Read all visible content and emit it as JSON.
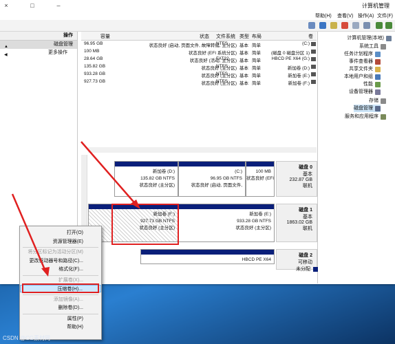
{
  "window": {
    "title": "计算机管理",
    "controls": {
      "close": "×",
      "maximize": "□",
      "minimize": "–"
    }
  },
  "menubar": [
    "文件(F)",
    "操作(A)",
    "查看(V)",
    "帮助(H)"
  ],
  "tree": {
    "items": [
      {
        "label": "计算机管理(本地)",
        "level": 0
      },
      {
        "label": "系统工具",
        "level": 1
      },
      {
        "label": "任务计划程序",
        "level": 2
      },
      {
        "label": "事件查看器",
        "level": 2
      },
      {
        "label": "共享文件夹",
        "level": 2
      },
      {
        "label": "本地用户和组",
        "level": 2
      },
      {
        "label": "性能",
        "level": 2
      },
      {
        "label": "设备管理器",
        "level": 2
      },
      {
        "label": "存储",
        "level": 1
      },
      {
        "label": "磁盘管理",
        "level": 2,
        "selected": true
      },
      {
        "label": "服务和应用程序",
        "level": 1
      }
    ]
  },
  "actions": {
    "header": "操作",
    "section": "磁盘管理",
    "more": "更多操作"
  },
  "table": {
    "columns": [
      "卷",
      "布局",
      "类型",
      "文件系统",
      "状态",
      "容量"
    ],
    "rows": [
      {
        "vol": "(C:)",
        "layout": "简单",
        "type": "基本",
        "fs": "NTFS",
        "status": "状态良好 (启动, 页面文件, 故障转储, 主分区)",
        "cap": "96.95 GB"
      },
      {
        "vol": "(磁盘 0 磁盘分区 1)",
        "layout": "简单",
        "type": "基本",
        "fs": "",
        "status": "状态良好 (EFI 系统分区)",
        "cap": "100 MB"
      },
      {
        "vol": "HBCD PE X64 (G:)",
        "layout": "简单",
        "type": "基本",
        "fs": "FAT32",
        "status": "状态良好 (活动, 主分区)",
        "cap": "28.64 GB"
      },
      {
        "vol": "新加卷 (D:)",
        "layout": "简单",
        "type": "基本",
        "fs": "NTFS",
        "status": "状态良好 (主分区)",
        "cap": "135.82 GB"
      },
      {
        "vol": "新加卷 (E:)",
        "layout": "简单",
        "type": "基本",
        "fs": "NTFS",
        "status": "状态良好 (主分区)",
        "cap": "933.28 GB"
      },
      {
        "vol": "新加卷 (F:)",
        "layout": "简单",
        "type": "基本",
        "fs": "NTFS",
        "status": "状态良好 (主分区)",
        "cap": "927.73 GB"
      }
    ]
  },
  "disks": [
    {
      "name": "磁盘 0",
      "type": "基本",
      "size": "232.87 GB",
      "state": "联机",
      "partitions": [
        {
          "label": "",
          "size": "100 MB",
          "status": "状态良好 (EFI"
        },
        {
          "label": "(C:)",
          "size": "96.95 GB NTFS",
          "status": "状态良好 (启动, 页面文件,"
        },
        {
          "label": "新加卷 (D:)",
          "size": "135.82 GB NTFS",
          "status": "状态良好 (主分区)"
        }
      ]
    },
    {
      "name": "磁盘 1",
      "type": "基本",
      "size": "1863.02 GB",
      "state": "联机",
      "partitions": [
        {
          "label": "新加卷 (E:)",
          "size": "933.28 GB NTFS",
          "status": "状态良好 (主分区)"
        },
        {
          "label": "新加卷 (F:)",
          "size": "927.73 GB NTFS",
          "status": "状态良好 (主分区)"
        }
      ]
    },
    {
      "name": "磁盘 2",
      "type": "可移动",
      "size": "",
      "state": "",
      "partitions": [
        {
          "label": "HBCD PE X64",
          "size": "",
          "status": ""
        }
      ]
    }
  ],
  "legend": {
    "unallocated": "未分配"
  },
  "context_menu": {
    "items": [
      {
        "label": "打开(O)",
        "enabled": true
      },
      {
        "label": "资源管理器(E)",
        "enabled": true
      },
      {
        "label": "将分区标记为活动分区(M)",
        "enabled": false
      },
      {
        "label": "更改驱动器号和路径(C)...",
        "enabled": true
      },
      {
        "label": "格式化(F)...",
        "enabled": true
      },
      {
        "label": "扩展卷(X)...",
        "enabled": false
      },
      {
        "label": "压缩卷(H)...",
        "enabled": true,
        "highlighted": true
      },
      {
        "label": "添加镜像(A)...",
        "enabled": false
      },
      {
        "label": "删除卷(D)...",
        "enabled": true
      },
      {
        "label": "属性(P)",
        "enabled": true
      },
      {
        "label": "帮助(H)",
        "enabled": true
      }
    ]
  },
  "watermark": "CSDN @CG素材网"
}
